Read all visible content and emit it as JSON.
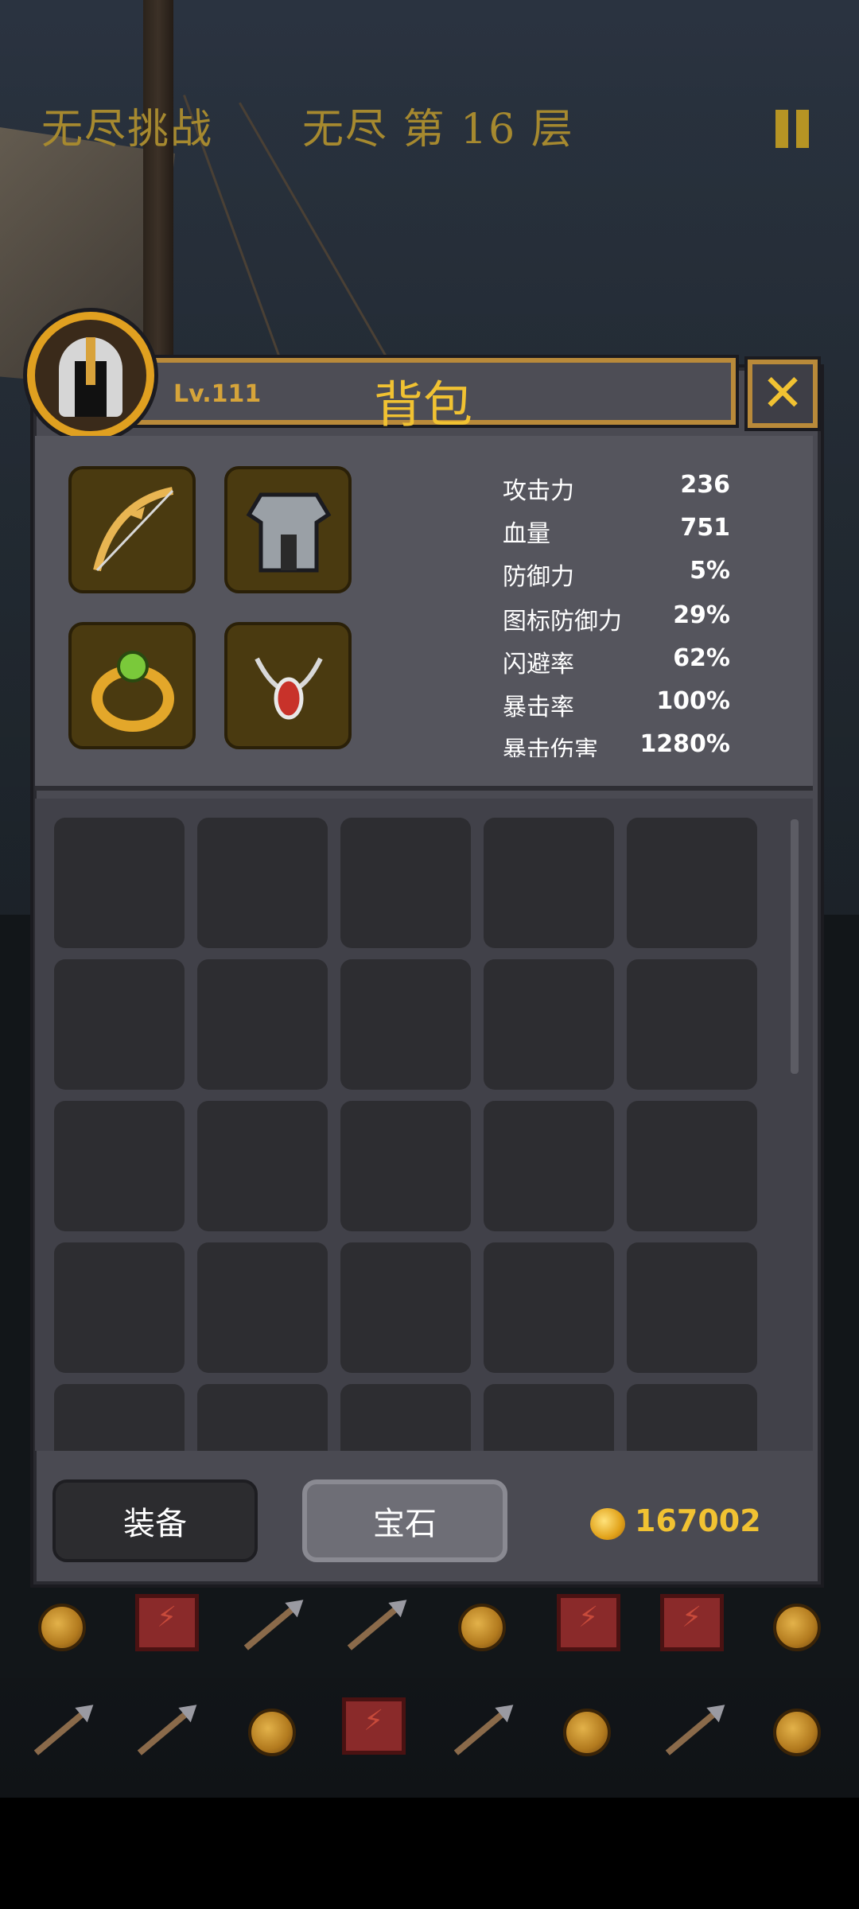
{
  "hud": {
    "mode_label": "无尽挑战",
    "floor_label": "无尽 第 16 层"
  },
  "player": {
    "level": "Lv.111"
  },
  "backpack": {
    "title": "背包",
    "close_icon": "✕",
    "equipment": [
      {
        "slot": "weapon",
        "icon": "bow-icon"
      },
      {
        "slot": "armor",
        "icon": "armor-icon"
      },
      {
        "slot": "ring",
        "icon": "ring-icon"
      },
      {
        "slot": "amulet",
        "icon": "amulet-icon"
      }
    ],
    "stats": [
      {
        "label": "攻击力",
        "value": "236"
      },
      {
        "label": "血量",
        "value": "751"
      },
      {
        "label": "防御力",
        "value": "5%"
      },
      {
        "label": "图标防御力",
        "value": "29%"
      },
      {
        "label": "闪避率",
        "value": "62%"
      },
      {
        "label": "暴击率",
        "value": "100%"
      },
      {
        "label": "暴击伤害",
        "value": "1280%"
      }
    ],
    "tabs": {
      "equipment": "装备",
      "gems": "宝石"
    },
    "gold": "167002"
  },
  "colors": {
    "accent_gold": "#f1c232",
    "frame_gold": "#b98a3a",
    "panel": "#4a4a52"
  }
}
